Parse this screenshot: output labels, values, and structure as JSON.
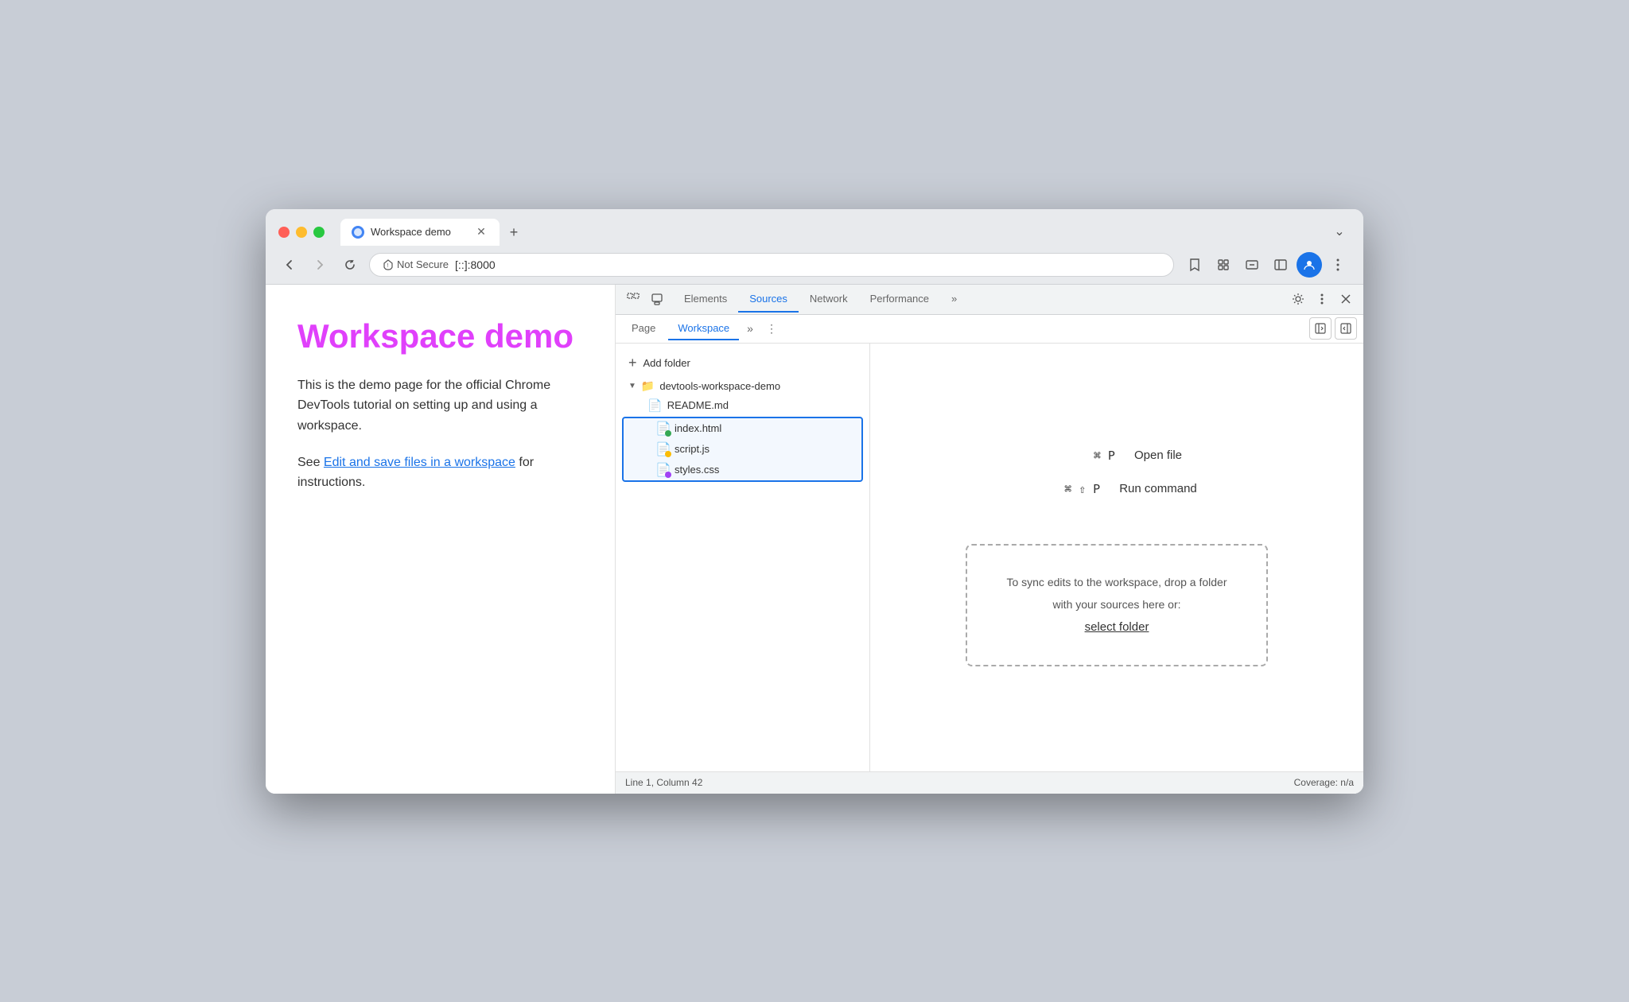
{
  "window": {
    "title": "Workspace demo"
  },
  "browser": {
    "back_disabled": false,
    "forward_disabled": true,
    "url_security": "Not Secure",
    "url_address": "[::]:8000",
    "new_tab_label": "+",
    "tab_more_label": "⌄"
  },
  "webpage": {
    "title": "Workspace demo",
    "description": "This is the demo page for the official Chrome DevTools tutorial on setting up and using a workspace.",
    "see_also_prefix": "See ",
    "link_text": "Edit and save files in a workspace",
    "see_also_suffix": " for instructions."
  },
  "devtools": {
    "tabs": [
      {
        "label": "Elements",
        "active": false
      },
      {
        "label": "Sources",
        "active": true
      },
      {
        "label": "Network",
        "active": false
      },
      {
        "label": "Performance",
        "active": false
      },
      {
        "label": "»",
        "active": false
      }
    ],
    "secondary_tabs": [
      {
        "label": "Page",
        "active": false
      },
      {
        "label": "Workspace",
        "active": true
      },
      {
        "label": "»",
        "active": false
      }
    ],
    "add_folder_label": "Add folder",
    "folder_name": "devtools-workspace-demo",
    "files": [
      {
        "name": "README.md",
        "dot_color": null,
        "highlighted": false
      },
      {
        "name": "index.html",
        "dot_color": "green",
        "highlighted": true
      },
      {
        "name": "script.js",
        "dot_color": "orange",
        "highlighted": true
      },
      {
        "name": "styles.css",
        "dot_color": "purple",
        "highlighted": true
      }
    ],
    "shortcuts": [
      {
        "keys": "⌘ P",
        "label": "Open file"
      },
      {
        "keys": "⌘ ⇧ P",
        "label": "Run command"
      }
    ],
    "drop_zone_text": "To sync edits to the workspace, drop a folder with your sources here or:",
    "select_folder_label": "select folder",
    "status_bar": {
      "left": "Line 1, Column 42",
      "right": "Coverage: n/a"
    }
  },
  "colors": {
    "page_title": "#e040fb",
    "active_tab": "#1a73e8",
    "highlight_border": "#1a73e8",
    "dot_green": "#34a853",
    "dot_orange": "#fbbc04",
    "dot_purple": "#a142f4"
  }
}
